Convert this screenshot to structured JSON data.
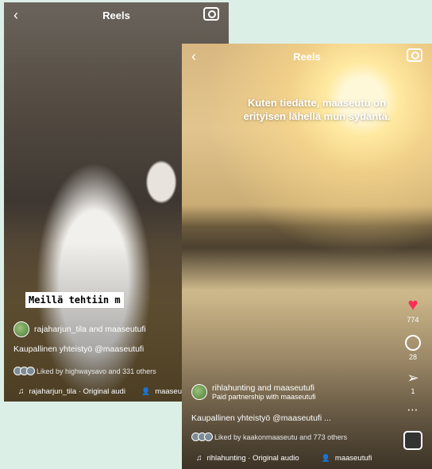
{
  "reel_left": {
    "header": {
      "back_icon": "‹",
      "title": "Reels"
    },
    "boxed_text": "Meillä tehtiin m",
    "user_line": "rajaharjun_tila and maaseutufi",
    "caption": "Kaupallinen yhteistyö @maaseutufi",
    "liked": "Liked by highwaysavo and 331 others",
    "audio": "rajaharjun_tila · Original audi",
    "tagged": "maaseutufi"
  },
  "reel_right": {
    "header": {
      "back_icon": "‹",
      "title": "Reels"
    },
    "overlay": "Kuten tiedätte, maaseutu on erityisen lähellä mun sydäntä.",
    "user_line": "rihlahunting and maaseutufi",
    "partnership": "Paid partnership with maaseutufi",
    "caption": "Kaupallinen yhteistyö @maaseutufi ...",
    "liked": "Liked by kaakonmaaseutu and 773 others",
    "audio": "rihlahunting · Original audio",
    "tagged": "maaseutufi",
    "actions": {
      "likes": "774",
      "comments": "28",
      "shares": "1"
    }
  }
}
